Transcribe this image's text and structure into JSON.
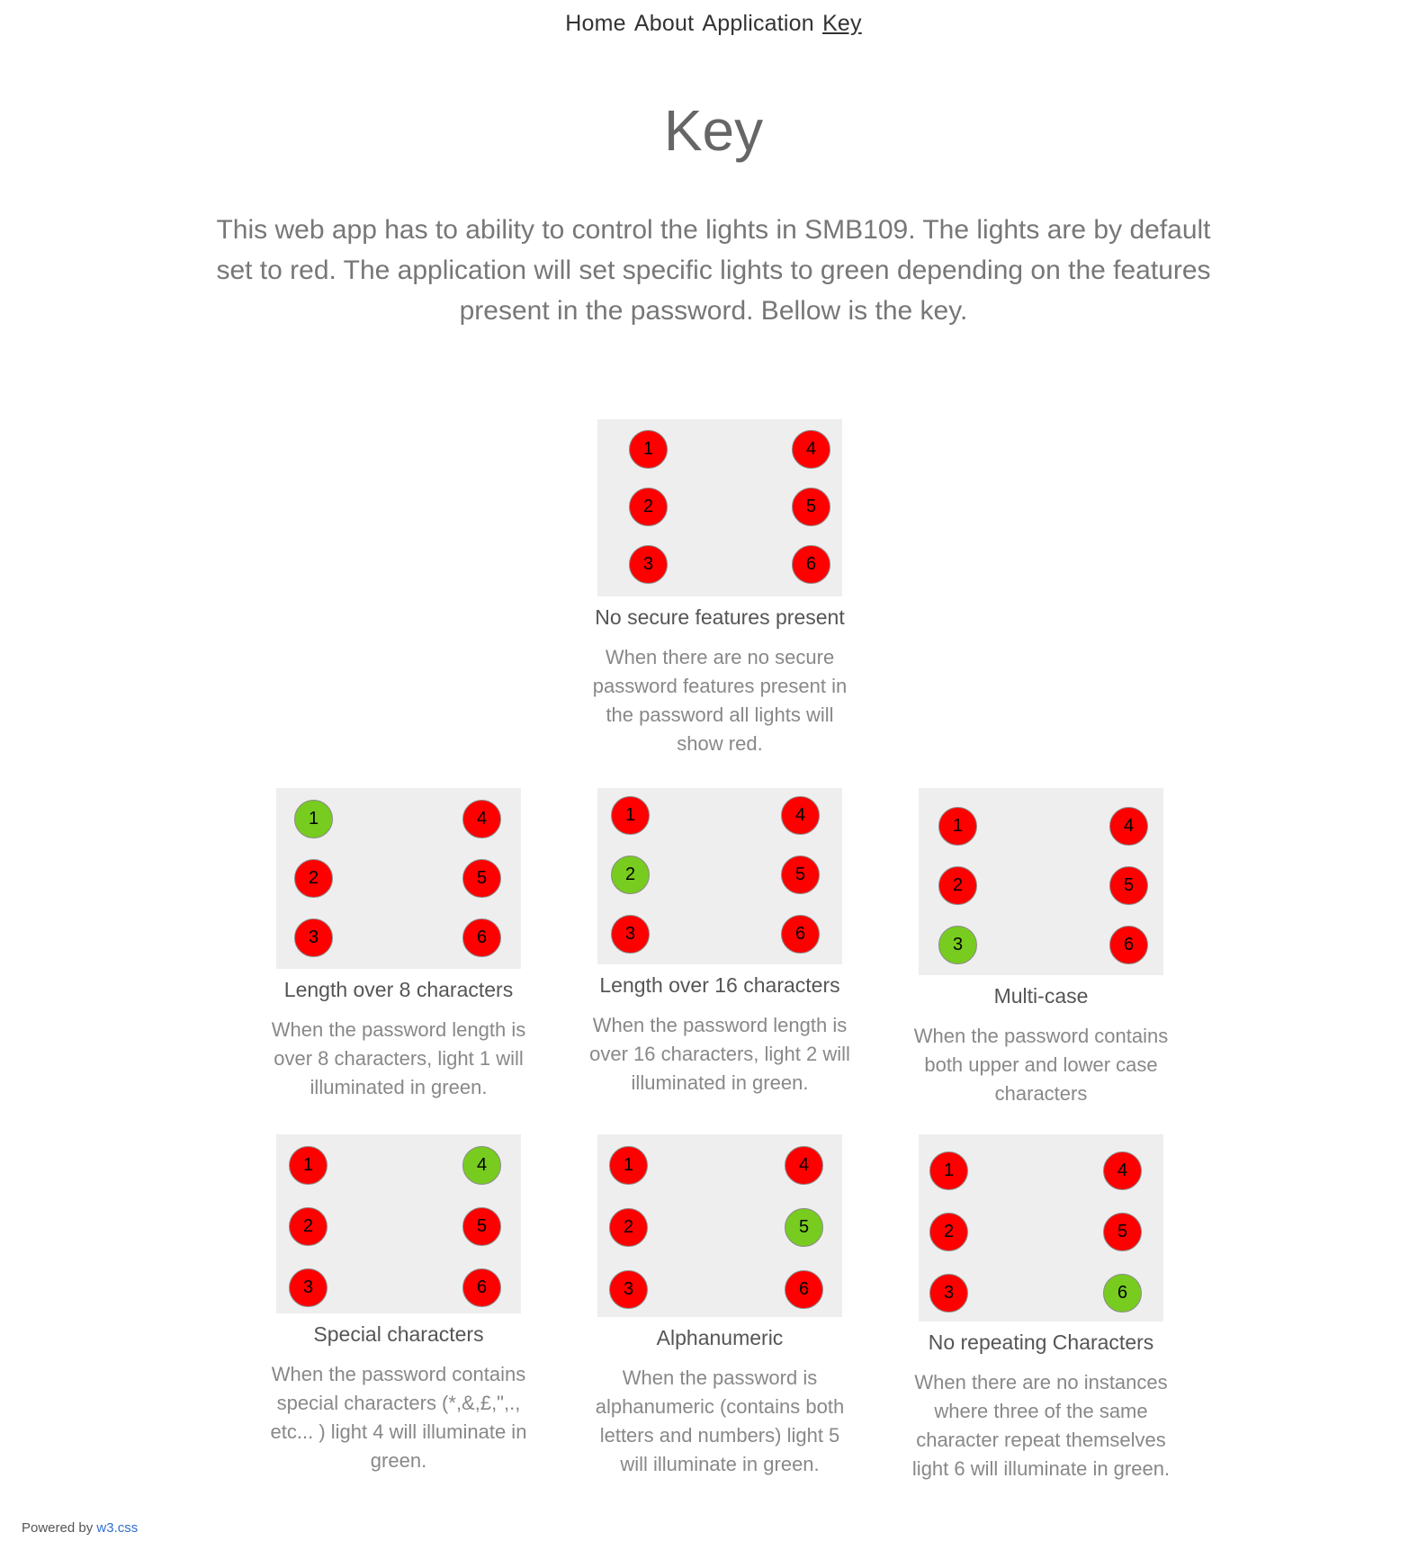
{
  "nav": {
    "items": [
      {
        "label": "Home",
        "name": "nav-home",
        "active": false
      },
      {
        "label": "About",
        "name": "nav-about",
        "active": false
      },
      {
        "label": "Application",
        "name": "nav-application",
        "active": false
      },
      {
        "label": "Key",
        "name": "nav-key",
        "active": true
      }
    ]
  },
  "page": {
    "title": "Key",
    "intro": "This web app has to ability to control the lights in SMB109. The lights are by default set to red. The application will set specific lights to green depending on the features present in the password. Bellow is the key."
  },
  "colors": {
    "red": "#ff0000",
    "green": "#77cc1f",
    "panel": "#eeeeee",
    "link": "#2f6fd1"
  },
  "cards": [
    {
      "title": "No secure features present",
      "description": "When there are no secure password features present in the password all lights will show red.",
      "green_lights": []
    },
    {
      "title": "Length over 8 characters",
      "description": "When the password length is over 8 characters, light 1 will illuminated in green.",
      "green_lights": [
        1
      ]
    },
    {
      "title": "Length over 16 characters",
      "description": "When the password length is over 16 characters, light 2 will illuminated in green.",
      "green_lights": [
        2
      ]
    },
    {
      "title": "Multi-case",
      "description": "When the password contains both upper and lower case characters",
      "green_lights": [
        3
      ]
    },
    {
      "title": "Special characters",
      "description": "When the password contains special characters (*,&,£,\",., etc... ) light 4 will illuminate in green.",
      "green_lights": [
        4
      ]
    },
    {
      "title": "Alphanumeric",
      "description": "When the password is alphanumeric (contains both letters and numbers) light 5 will illuminate in green.",
      "green_lights": [
        5
      ]
    },
    {
      "title": "No repeating Characters",
      "description": "When there are no instances where three of the same character repeat themselves light 6 will illuminate in green.",
      "green_lights": [
        6
      ]
    }
  ],
  "footer": {
    "text": "Powered by ",
    "link_label": "w3.css"
  }
}
